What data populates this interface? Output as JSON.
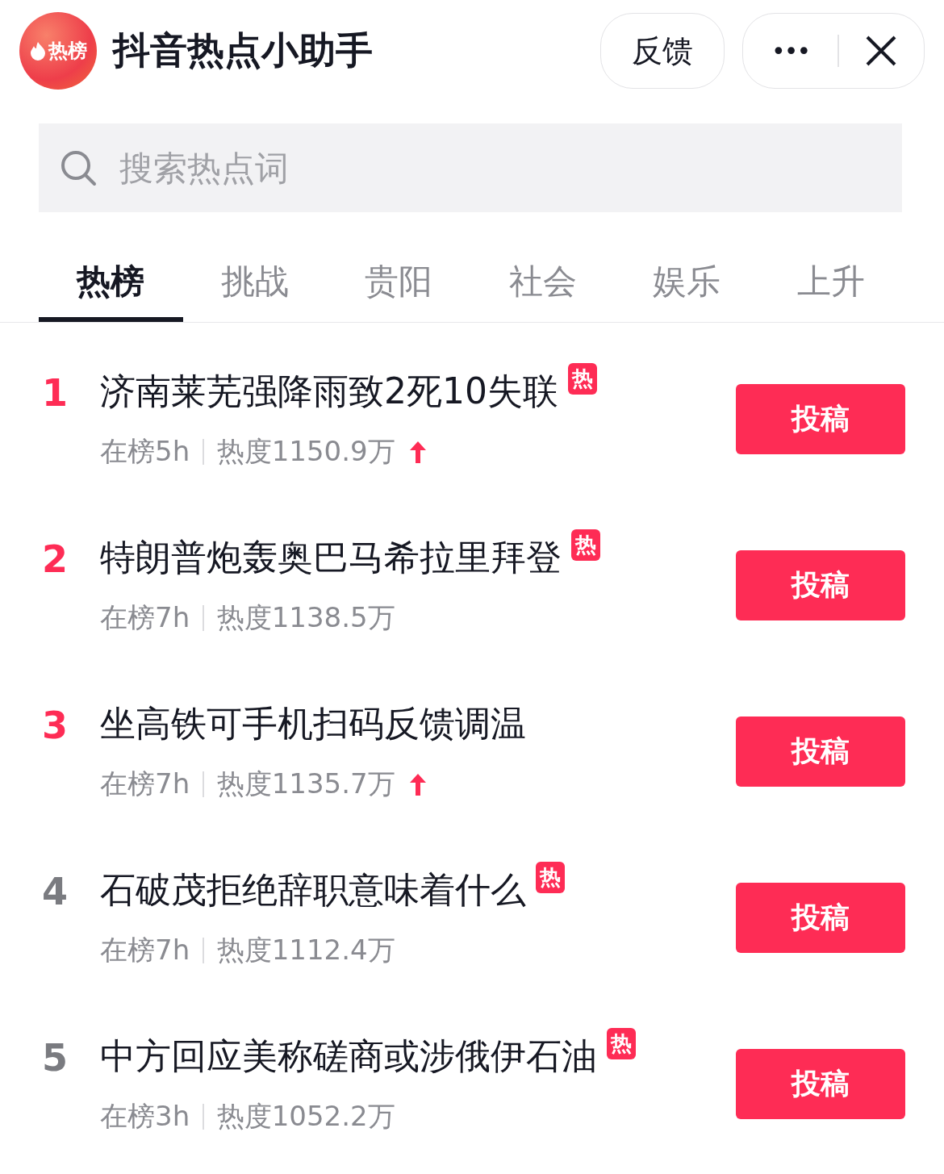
{
  "header": {
    "logo_text": "热榜",
    "title": "抖音热点小助手",
    "feedback_button": "反馈",
    "more_button": "•••"
  },
  "search": {
    "placeholder": "搜索热点词"
  },
  "tabs": [
    {
      "label": "热榜",
      "selected": true
    },
    {
      "label": "挑战",
      "selected": false
    },
    {
      "label": "贵阳",
      "selected": false
    },
    {
      "label": "社会",
      "selected": false
    },
    {
      "label": "娱乐",
      "selected": false
    },
    {
      "label": "上升",
      "selected": false
    }
  ],
  "items": [
    {
      "rank": "1",
      "highlighted": true,
      "title": "济南莱芜强降雨致2死10失联",
      "badge": "热",
      "duration": "在榜5h",
      "heat": "热度1150.9万",
      "rising": true,
      "button": "投稿"
    },
    {
      "rank": "2",
      "highlighted": true,
      "title": "特朗普炮轰奥巴马希拉里拜登",
      "badge": "热",
      "duration": "在榜7h",
      "heat": "热度1138.5万",
      "rising": false,
      "button": "投稿"
    },
    {
      "rank": "3",
      "highlighted": true,
      "title": "坐高铁可手机扫码反馈调温",
      "duration": "在榜7h",
      "heat": "热度1135.7万",
      "rising": true,
      "button": "投稿"
    },
    {
      "rank": "4",
      "highlighted": false,
      "title": "石破茂拒绝辞职意味着什么",
      "badge": "热",
      "duration": "在榜7h",
      "heat": "热度1112.4万",
      "rising": false,
      "button": "投稿"
    },
    {
      "rank": "5",
      "highlighted": false,
      "title": "中方回应美称磋商或涉俄伊石油",
      "badge": "热",
      "duration": "在榜3h",
      "heat": "热度1052.2万",
      "rising": false,
      "button": "投稿"
    }
  ]
}
